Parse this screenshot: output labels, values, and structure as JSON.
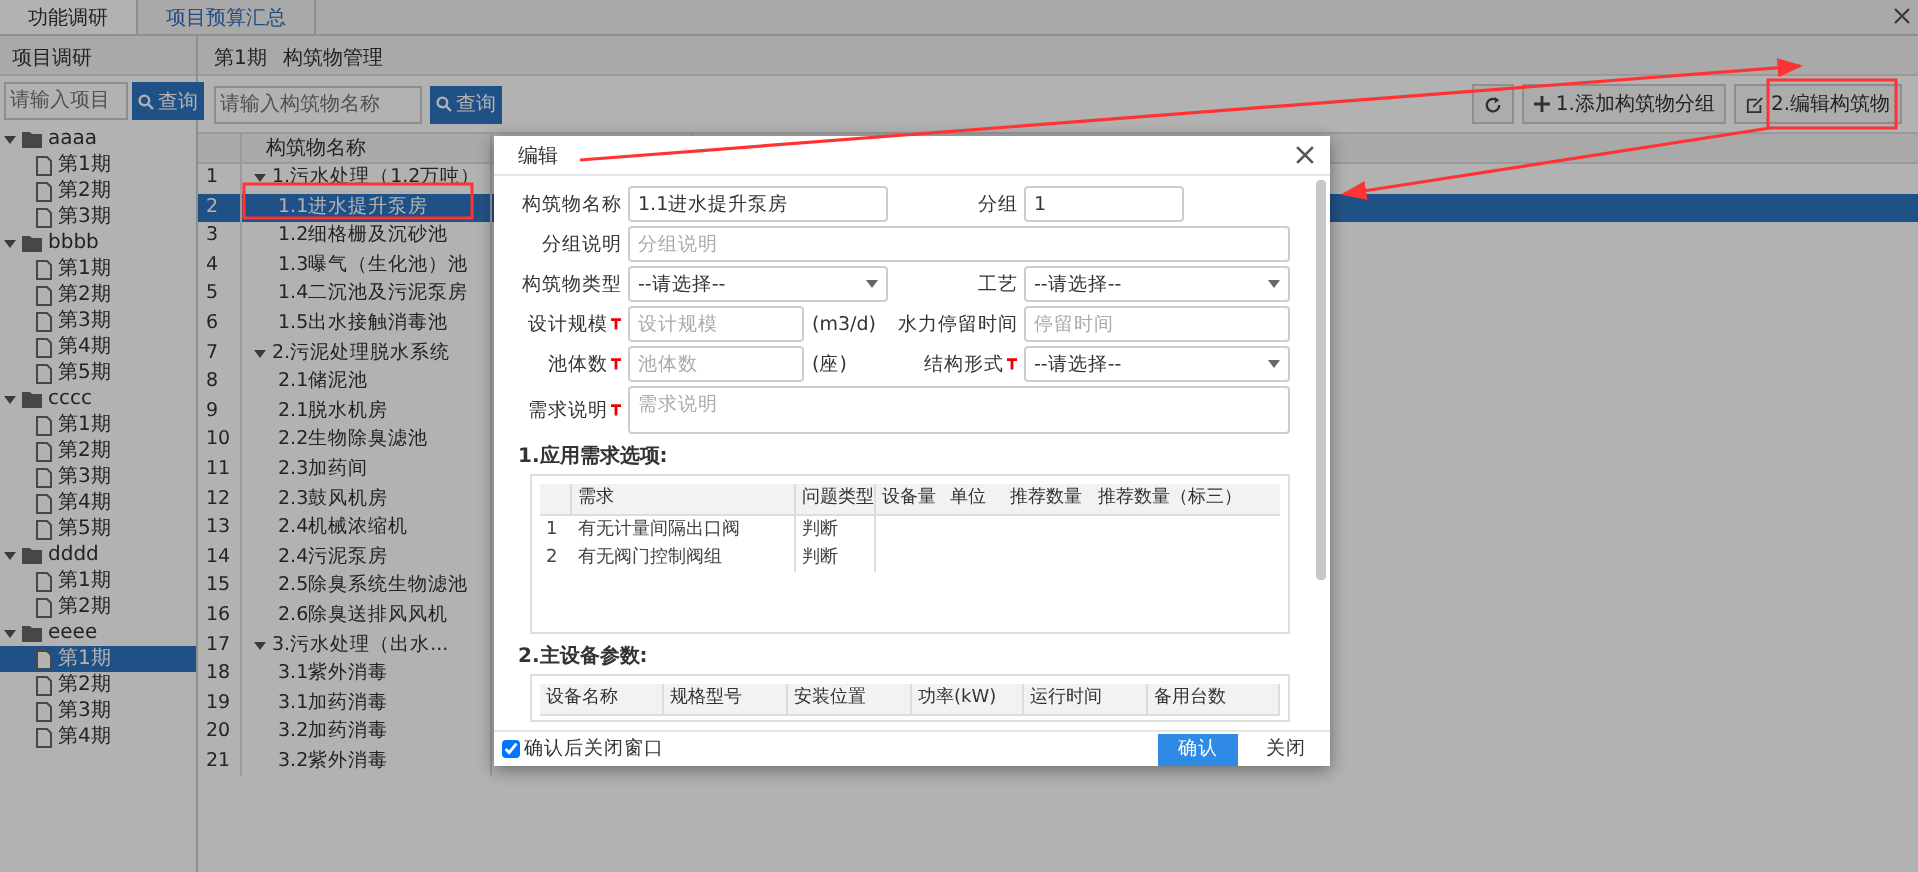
{
  "tabs": [
    {
      "label": "功能调研",
      "selected": true
    },
    {
      "label": "项目预算汇总",
      "selected": false
    }
  ],
  "sidebar": {
    "title": "项目调研",
    "search": {
      "placeholder": "请输入项目"
    },
    "search_button": "查询",
    "tree": [
      {
        "label": "aaaa",
        "expanded": true,
        "children": [
          {
            "label": "第1期",
            "selected": false
          },
          {
            "label": "第2期",
            "selected": false
          },
          {
            "label": "第3期",
            "selected": false
          }
        ]
      },
      {
        "label": "bbbb",
        "expanded": true,
        "children": [
          {
            "label": "第1期",
            "selected": false
          },
          {
            "label": "第2期",
            "selected": false
          },
          {
            "label": "第3期",
            "selected": false
          },
          {
            "label": "第4期",
            "selected": false
          },
          {
            "label": "第5期",
            "selected": false
          }
        ]
      },
      {
        "label": "cccc",
        "expanded": true,
        "children": [
          {
            "label": "第1期",
            "selected": false
          },
          {
            "label": "第2期",
            "selected": false
          },
          {
            "label": "第3期",
            "selected": false
          },
          {
            "label": "第4期",
            "selected": false
          },
          {
            "label": "第5期",
            "selected": false
          }
        ]
      },
      {
        "label": "dddd",
        "expanded": true,
        "children": [
          {
            "label": "第1期",
            "selected": false
          },
          {
            "label": "第2期",
            "selected": false
          }
        ]
      },
      {
        "label": "eeee",
        "expanded": true,
        "children": [
          {
            "label": "第1期",
            "selected": true
          },
          {
            "label": "第2期",
            "selected": false
          },
          {
            "label": "第3期",
            "selected": false
          },
          {
            "label": "第4期",
            "selected": false
          }
        ]
      }
    ]
  },
  "main": {
    "breadcrumb": [
      "第1期",
      "构筑物管理"
    ],
    "search": {
      "placeholder": "请输入构筑物名称"
    },
    "search_button": "查询",
    "toolbar": [
      {
        "kind": "refresh"
      },
      {
        "kind": "add",
        "label": "1.添加构筑物分组"
      },
      {
        "kind": "edit",
        "label": "2.编辑构筑物"
      }
    ],
    "table": {
      "columns": [
        "构筑物名称"
      ],
      "rows": [
        {
          "number": "1",
          "kind": "group",
          "expanded": true,
          "name": "1.污水处理（1.2万吨）",
          "selected": false
        },
        {
          "number": "2",
          "kind": "item",
          "name": "1.1进水提升泵房",
          "selected": true
        },
        {
          "number": "3",
          "kind": "item",
          "name": "1.2细格栅及沉砂池",
          "selected": false
        },
        {
          "number": "4",
          "kind": "item",
          "name": "1.3曝气（生化池）池",
          "selected": false
        },
        {
          "number": "5",
          "kind": "item",
          "name": "1.4二沉池及污泥泵房",
          "selected": false
        },
        {
          "number": "6",
          "kind": "item",
          "name": "1.5出水接触消毒池",
          "selected": false
        },
        {
          "number": "7",
          "kind": "group",
          "expanded": true,
          "name": "2.污泥处理脱水系统",
          "selected": false
        },
        {
          "number": "8",
          "kind": "item",
          "name": "2.1储泥池",
          "selected": false
        },
        {
          "number": "9",
          "kind": "item",
          "name": "2.1脱水机房",
          "selected": false
        },
        {
          "number": "10",
          "kind": "item",
          "name": "2.2生物除臭滤池",
          "selected": false
        },
        {
          "number": "11",
          "kind": "item",
          "name": "2.3加药间",
          "selected": false
        },
        {
          "number": "12",
          "kind": "item",
          "name": "2.3鼓风机房",
          "selected": false
        },
        {
          "number": "13",
          "kind": "item",
          "name": "2.4机械浓缩机",
          "selected": false
        },
        {
          "number": "14",
          "kind": "item",
          "name": "2.4污泥泵房",
          "selected": false
        },
        {
          "number": "15",
          "kind": "item",
          "name": "2.5除臭系统生物滤池",
          "selected": false
        },
        {
          "number": "16",
          "kind": "item",
          "name": "2.6除臭送排风风机",
          "selected": false
        },
        {
          "number": "17",
          "kind": "group",
          "expanded": true,
          "name": "3.污水处理（出水...",
          "selected": false
        },
        {
          "number": "18",
          "kind": "item",
          "name": "3.1紫外消毒",
          "selected": false
        },
        {
          "number": "19",
          "kind": "item",
          "name": "3.1加药消毒",
          "selected": false
        },
        {
          "number": "20",
          "kind": "item",
          "name": "3.2加药消毒",
          "selected": false
        },
        {
          "number": "21",
          "kind": "item",
          "name": "3.2紫外消毒",
          "selected": false
        }
      ]
    }
  },
  "dialog": {
    "title": "编辑",
    "fields": [
      {
        "label": "构筑物名称",
        "kind": "input",
        "value": "1.1进水提升泵房",
        "required": false,
        "wide": false
      },
      {
        "label": "分组",
        "kind": "input",
        "value": "1",
        "required": false,
        "wide": false,
        "short": true
      },
      {
        "label": "分组说明",
        "kind": "input",
        "placeholder": "分组说明",
        "required": false,
        "wide": true
      },
      {
        "label": "构筑物类型",
        "kind": "select",
        "value": "--请选择--",
        "required": false,
        "wide": false
      },
      {
        "label": "工艺",
        "kind": "select",
        "value": "--请选择--",
        "required": false,
        "wide": false
      },
      {
        "label": "设计规模",
        "kind": "input",
        "placeholder": "设计规模",
        "unit": "(m3/d)",
        "required": true,
        "wide": false
      },
      {
        "label": "水力停留时间",
        "kind": "input",
        "placeholder": "停留时间",
        "required": false,
        "wide": false
      },
      {
        "label": "池体数",
        "kind": "input",
        "placeholder": "池体数",
        "unit": "(座)",
        "required": true,
        "wide": false
      },
      {
        "label": "结构形式",
        "kind": "select",
        "value": "--请选择--",
        "required": true,
        "wide": false
      },
      {
        "label": "需求说明",
        "kind": "textarea",
        "placeholder": "需求说明",
        "required": true,
        "wide": true
      }
    ],
    "sections": [
      {
        "title": "1.应用需求选项:",
        "columns": [
          "需求",
          "问题类型",
          "设备量",
          "单位",
          "推荐数量",
          "推荐数量（标三）"
        ],
        "rows": [
          {
            "number": "1",
            "cells": [
              "有无计量间隔出口阀",
              "判断"
            ]
          },
          {
            "number": "2",
            "cells": [
              "有无阀门控制阀组",
              "判断"
            ]
          }
        ]
      },
      {
        "title": "2.主设备参数:",
        "columns": [
          "设备名称",
          "规格型号",
          "安装位置",
          "功率(kW)",
          "运行时间",
          "备用台数"
        ]
      }
    ],
    "close_after_confirm": {
      "label": "确认后关闭窗口",
      "checked": true
    },
    "buttons": [
      {
        "label": "确认",
        "primary": true
      },
      {
        "label": "关闭",
        "primary": false
      }
    ]
  }
}
